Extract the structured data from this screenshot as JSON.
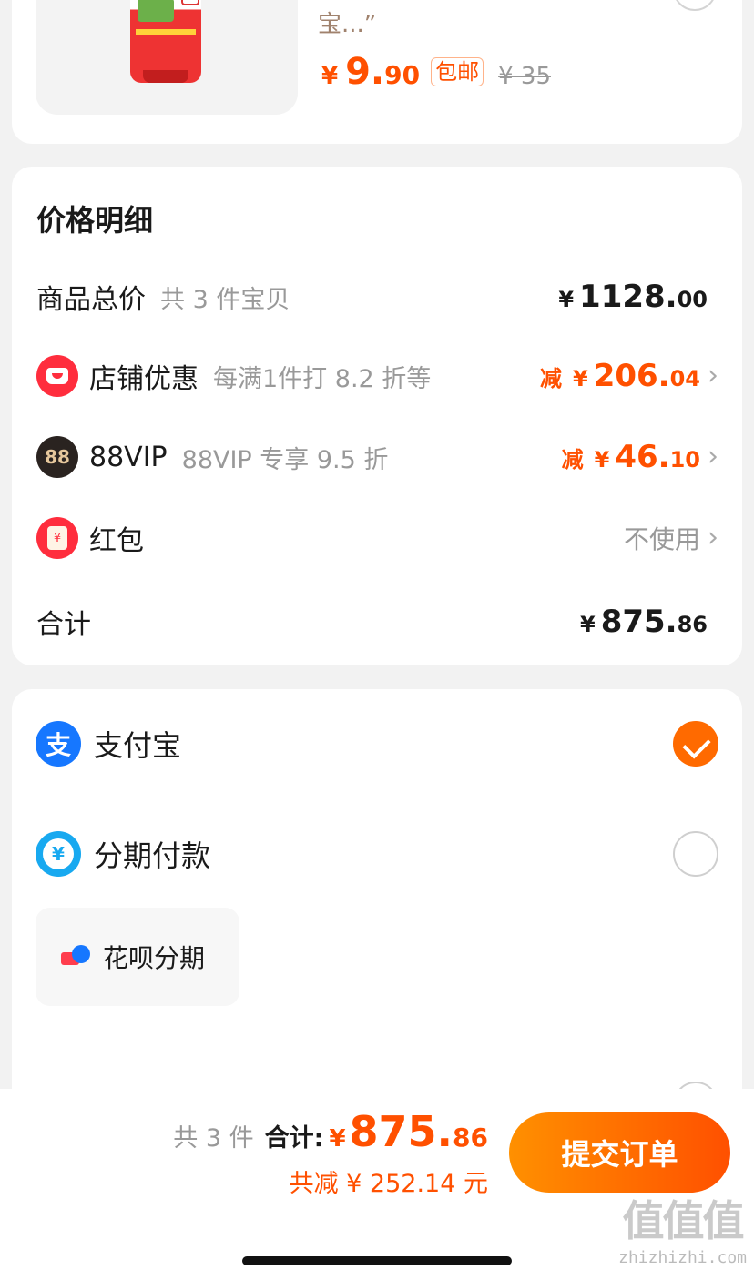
{
  "product": {
    "desc": "宝...”",
    "price_symbol": "¥",
    "price_int": "9.",
    "price_dec": "90",
    "shipping_tag": "包邮",
    "original_price": "¥ 35"
  },
  "price_detail": {
    "title": "价格明细",
    "goods_total": {
      "label": "商品总价",
      "sub": "共 3 件宝贝",
      "symbol": "¥",
      "int": "1128.",
      "dec": "00"
    },
    "shop_discount": {
      "label": "店铺优惠",
      "sub": "每满1件打 8.2 折等",
      "prefix": "减",
      "symbol": "¥",
      "int": "206.",
      "dec": "04"
    },
    "vip": {
      "icon_text": "88",
      "label": "88VIP",
      "sub": "88VIP 专享 9.5 折",
      "prefix": "减",
      "symbol": "¥",
      "int": "46.",
      "dec": "10"
    },
    "red_packet": {
      "icon_text": "¥",
      "label": "红包",
      "value": "不使用"
    },
    "total": {
      "label": "合计",
      "symbol": "¥",
      "int": "875.",
      "dec": "86"
    }
  },
  "payment": {
    "alipay": {
      "label": "支付宝",
      "icon_text": "支",
      "checked": true
    },
    "installment": {
      "label": "分期付款",
      "icon_text": "¥",
      "checked": false
    },
    "huabei": {
      "label": "花呗分期"
    }
  },
  "bottom_bar": {
    "count": "共 3 件",
    "total_label": "合计:",
    "symbol": "¥",
    "int": "875.",
    "dec": "86",
    "saved": "共减 ¥ 252.14 元",
    "submit_label": "提交订单"
  },
  "watermark": {
    "big": "值值值",
    "small": "zhizhizhi.com"
  },
  "colors": {
    "accent": "#ff5000",
    "alipay": "#1677ff",
    "bg": "#f2f2f2"
  }
}
